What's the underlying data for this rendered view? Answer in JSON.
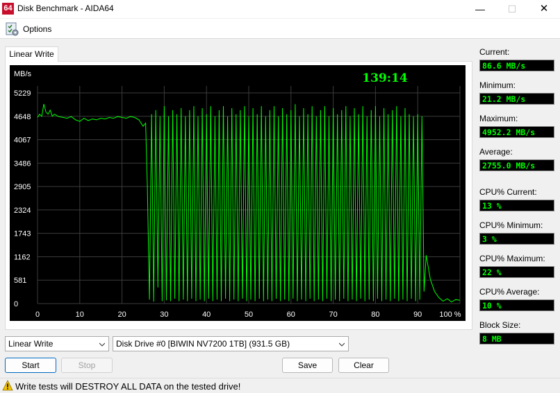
{
  "window": {
    "app_icon_text": "64",
    "title": "Disk Benchmark - AIDA64",
    "minimize_glyph": "—",
    "maximize_glyph": "☐",
    "close_glyph": "✕"
  },
  "menu": {
    "options_label": "Options",
    "options_icon": "options-checklist-icon"
  },
  "tab": {
    "label": "Linear Write"
  },
  "chart_data": {
    "type": "line",
    "title": "",
    "xlabel": "",
    "ylabel": "MB/s",
    "timer": "139:14",
    "xlim": [
      0,
      100
    ],
    "ylim": [
      0,
      5229
    ],
    "x_ticks": [
      "0",
      "10",
      "20",
      "30",
      "40",
      "50",
      "60",
      "70",
      "80",
      "90",
      "100 %"
    ],
    "y_ticks": [
      "5229",
      "4648",
      "4067",
      "3486",
      "2905",
      "2324",
      "1743",
      "1162",
      "581",
      "0"
    ],
    "grid": true,
    "colors": {
      "line": "#00ff00",
      "background": "#000000",
      "grid": "#3c3c3c",
      "axis_text": "#ffffff",
      "timer": "#00ff00"
    },
    "series": [
      {
        "values": [
          [
            0,
            4620
          ],
          [
            0.5,
            4700
          ],
          [
            1,
            4650
          ],
          [
            1.5,
            4952
          ],
          [
            2,
            4750
          ],
          [
            2.5,
            4700
          ],
          [
            3,
            4800
          ],
          [
            3.5,
            4650
          ],
          [
            4,
            4700
          ],
          [
            5,
            4640
          ],
          [
            6,
            4620
          ],
          [
            7,
            4600
          ],
          [
            8,
            4640
          ],
          [
            9,
            4560
          ],
          [
            10,
            4520
          ],
          [
            11,
            4600
          ],
          [
            12,
            4540
          ],
          [
            13,
            4580
          ],
          [
            14,
            4560
          ],
          [
            15,
            4600
          ],
          [
            16,
            4580
          ],
          [
            17,
            4620
          ],
          [
            18,
            4600
          ],
          [
            19,
            4640
          ],
          [
            20,
            4620
          ],
          [
            21,
            4600
          ],
          [
            22,
            4640
          ],
          [
            23,
            4620
          ],
          [
            24,
            4560
          ],
          [
            25,
            4400
          ],
          [
            25.6,
            4480
          ],
          [
            26,
            2900
          ],
          [
            26.5,
            100
          ],
          [
            27,
            4700
          ],
          [
            27.5,
            50
          ],
          [
            28,
            4800
          ],
          [
            28.5,
            400
          ],
          [
            29,
            4650
          ],
          [
            29.5,
            60
          ],
          [
            30,
            4900
          ],
          [
            30.5,
            80
          ],
          [
            31,
            4650
          ],
          [
            31.5,
            60
          ],
          [
            32,
            4800
          ],
          [
            32.5,
            120
          ],
          [
            33,
            4700
          ],
          [
            33.5,
            60
          ],
          [
            34,
            4850
          ],
          [
            34.5,
            100
          ],
          [
            35,
            4650
          ],
          [
            35.5,
            60
          ],
          [
            36,
            4800
          ],
          [
            36.5,
            120
          ],
          [
            37,
            4900
          ],
          [
            37.5,
            60
          ],
          [
            38,
            4650
          ],
          [
            38.5,
            100
          ],
          [
            39,
            4850
          ],
          [
            39.5,
            60
          ],
          [
            40,
            4700
          ],
          [
            40.5,
            120
          ],
          [
            41,
            4900
          ],
          [
            41.5,
            60
          ],
          [
            42,
            4650
          ],
          [
            42.5,
            100
          ],
          [
            43,
            4800
          ],
          [
            43.5,
            60
          ],
          [
            44,
            4900
          ],
          [
            44.5,
            120
          ],
          [
            45,
            4650
          ],
          [
            45.5,
            60
          ],
          [
            46,
            4850
          ],
          [
            46.5,
            100
          ],
          [
            47,
            4700
          ],
          [
            47.5,
            60
          ],
          [
            48,
            4800
          ],
          [
            48.5,
            120
          ],
          [
            49,
            4900
          ],
          [
            49.5,
            60
          ],
          [
            50,
            4650
          ],
          [
            50.5,
            100
          ],
          [
            51,
            4850
          ],
          [
            51.5,
            60
          ],
          [
            52,
            4700
          ],
          [
            52.5,
            120
          ],
          [
            53,
            4900
          ],
          [
            53.5,
            60
          ],
          [
            54,
            4650
          ],
          [
            54.5,
            100
          ],
          [
            55,
            4800
          ],
          [
            55.5,
            60
          ],
          [
            56,
            4900
          ],
          [
            56.5,
            120
          ],
          [
            57,
            4650
          ],
          [
            57.5,
            60
          ],
          [
            58,
            4850
          ],
          [
            58.5,
            100
          ],
          [
            59,
            4700
          ],
          [
            59.5,
            60
          ],
          [
            60,
            4800
          ],
          [
            60.5,
            120
          ],
          [
            61,
            4950
          ],
          [
            61.5,
            60
          ],
          [
            62,
            4650
          ],
          [
            62.5,
            100
          ],
          [
            63,
            4850
          ],
          [
            63.5,
            60
          ],
          [
            64,
            4700
          ],
          [
            64.5,
            120
          ],
          [
            65,
            4900
          ],
          [
            65.5,
            60
          ],
          [
            66,
            4650
          ],
          [
            66.5,
            100
          ],
          [
            67,
            4800
          ],
          [
            67.5,
            60
          ],
          [
            68,
            4900
          ],
          [
            68.5,
            120
          ],
          [
            69,
            4650
          ],
          [
            69.5,
            60
          ],
          [
            70,
            4850
          ],
          [
            70.5,
            100
          ],
          [
            71,
            4700
          ],
          [
            71.5,
            60
          ],
          [
            72,
            4800
          ],
          [
            72.5,
            120
          ],
          [
            73,
            4900
          ],
          [
            73.5,
            60
          ],
          [
            74,
            4650
          ],
          [
            74.5,
            100
          ],
          [
            75,
            4850
          ],
          [
            75.5,
            60
          ],
          [
            76,
            4700
          ],
          [
            76.5,
            120
          ],
          [
            77,
            4900
          ],
          [
            77.5,
            60
          ],
          [
            78,
            4650
          ],
          [
            78.5,
            100
          ],
          [
            79,
            4800
          ],
          [
            79.5,
            60
          ],
          [
            80,
            4900
          ],
          [
            80.5,
            120
          ],
          [
            81,
            4650
          ],
          [
            81.5,
            60
          ],
          [
            82,
            4850
          ],
          [
            82.5,
            100
          ],
          [
            83,
            4700
          ],
          [
            83.5,
            60
          ],
          [
            84,
            4800
          ],
          [
            84.5,
            120
          ],
          [
            85,
            4900
          ],
          [
            85.5,
            60
          ],
          [
            86,
            4650
          ],
          [
            86.5,
            100
          ],
          [
            87,
            4850
          ],
          [
            87.5,
            60
          ],
          [
            88,
            4700
          ],
          [
            88.5,
            120
          ],
          [
            89,
            4650
          ],
          [
            89.5,
            60
          ],
          [
            90,
            4700
          ],
          [
            90.5,
            100
          ],
          [
            91,
            4650
          ],
          [
            91.5,
            300
          ],
          [
            92,
            1200
          ],
          [
            93,
            600
          ],
          [
            94,
            300
          ],
          [
            95,
            150
          ],
          [
            96,
            60
          ],
          [
            97,
            120
          ],
          [
            98,
            40
          ],
          [
            99,
            100
          ],
          [
            100,
            80
          ]
        ]
      }
    ]
  },
  "stats": {
    "current_label": "Current:",
    "current_value": "86.6 MB/s",
    "minimum_label": "Minimum:",
    "minimum_value": "21.2 MB/s",
    "maximum_label": "Maximum:",
    "maximum_value": "4952.2 MB/s",
    "average_label": "Average:",
    "average_value": "2755.0 MB/s",
    "cpu_current_label": "CPU% Current:",
    "cpu_current_value": "13 %",
    "cpu_minimum_label": "CPU% Minimum:",
    "cpu_minimum_value": "3 %",
    "cpu_maximum_label": "CPU% Maximum:",
    "cpu_maximum_value": "22 %",
    "cpu_average_label": "CPU% Average:",
    "cpu_average_value": "10 %",
    "block_size_label": "Block Size:",
    "block_size_value": "8 MB"
  },
  "controls": {
    "test_select_value": "Linear Write",
    "drive_select_value": "Disk Drive #0  [BIWIN NV7200 1TB]  (931.5 GB)",
    "start_label": "Start",
    "stop_label": "Stop",
    "save_label": "Save",
    "clear_label": "Clear"
  },
  "status": {
    "warning_text": "Write tests will DESTROY ALL DATA on the tested drive!"
  }
}
